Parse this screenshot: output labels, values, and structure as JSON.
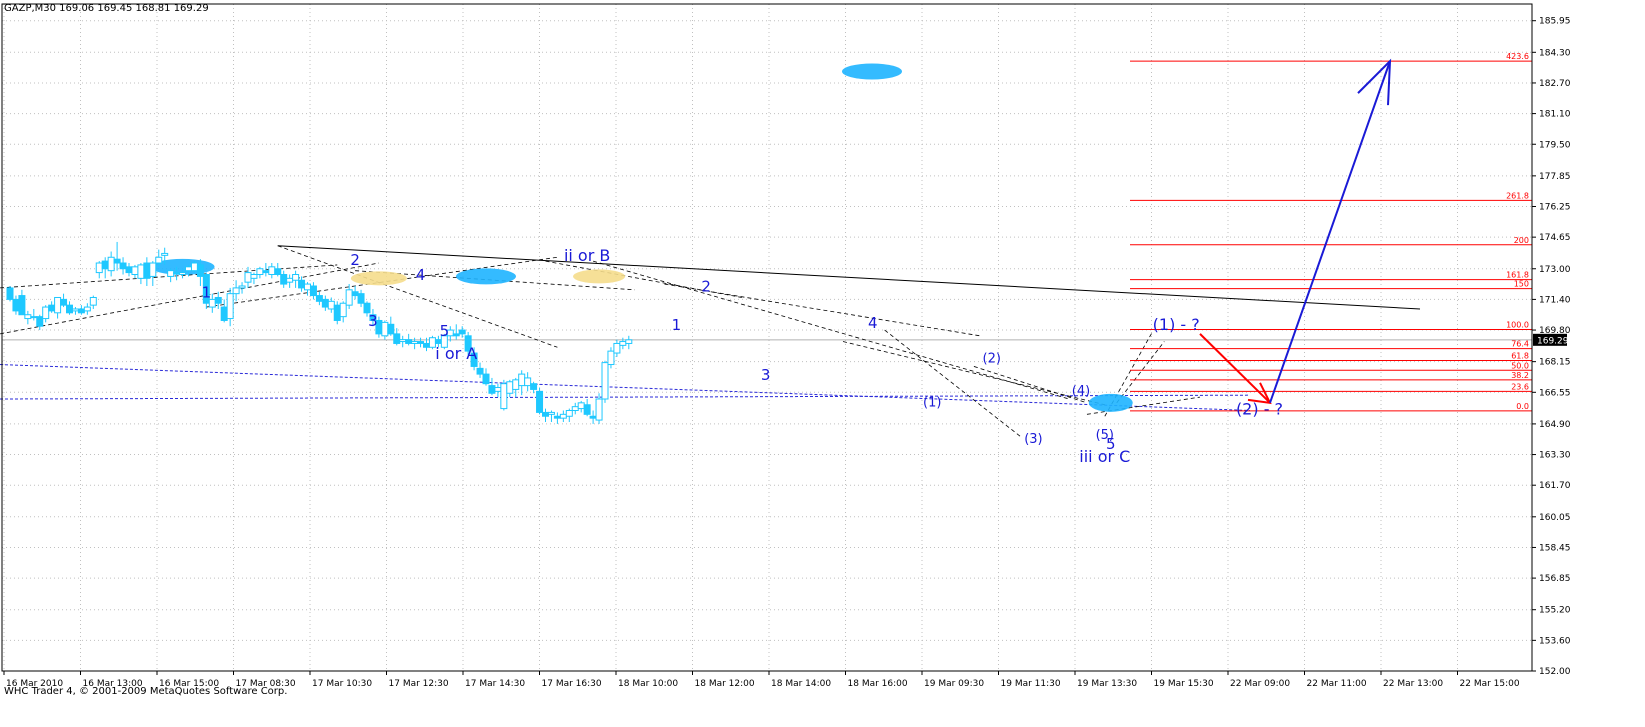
{
  "header": {
    "symbol_line": "GAZP,M30  169.06 169.45 168.81 169.29"
  },
  "footer": {
    "copyright": "WHC Trader 4, © 2001-2009 MetaQuotes Software Corp."
  },
  "colors": {
    "background": "#ffffff",
    "grid": "#c0c0c0",
    "bull": "#ffffff",
    "bear": "#1ec8ff",
    "candle_outline": "#1ec8ff",
    "fib": "#ff0000",
    "wave_label": "#1a1ad6",
    "arrow_up": "#1a1ad6",
    "arrow_down": "#ff0000",
    "highlight": "#f5dd8c",
    "marker": "#1eb4ff"
  },
  "chart_data": {
    "type": "candlestick",
    "ylim": [
      152.0,
      186.3
    ],
    "y_ticks": [
      "185.95",
      "184.30",
      "182.70",
      "181.10",
      "179.50",
      "177.85",
      "176.25",
      "174.65",
      "173.00",
      "171.40",
      "169.80",
      "168.15",
      "166.55",
      "164.90",
      "163.30",
      "161.70",
      "160.05",
      "158.45",
      "156.85",
      "155.20",
      "153.60",
      "152.00"
    ],
    "x_ticks": [
      "16 Mar 2010",
      "16 Mar 13:00",
      "16 Mar 15:00",
      "17 Mar 08:30",
      "17 Mar 10:30",
      "17 Mar 12:30",
      "17 Mar 14:30",
      "17 Mar 16:30",
      "18 Mar 10:00",
      "18 Mar 12:00",
      "18 Mar 14:00",
      "18 Mar 16:00",
      "19 Mar 09:30",
      "19 Mar 11:30",
      "19 Mar 13:30",
      "19 Mar 15:30",
      "22 Mar 09:00",
      "22 Mar 11:00",
      "22 Mar 13:00",
      "22 Mar 15:00"
    ],
    "current_price": "169.29",
    "candles": [
      [
        172.0,
        172.1,
        171.3,
        171.4
      ],
      [
        171.4,
        171.6,
        170.6,
        170.8
      ],
      [
        171.6,
        171.9,
        170.6,
        170.6
      ],
      [
        170.4,
        170.8,
        170.1,
        170.6
      ],
      [
        170.5,
        170.9,
        170.3,
        170.5
      ],
      [
        170.5,
        170.6,
        169.8,
        170.0
      ],
      [
        170.4,
        171.1,
        170.2,
        171.0
      ],
      [
        171.1,
        171.3,
        170.7,
        170.8
      ],
      [
        170.7,
        171.5,
        170.4,
        171.5
      ],
      [
        171.4,
        171.7,
        171.0,
        171.1
      ],
      [
        171.1,
        171.3,
        170.6,
        170.7
      ],
      [
        170.8,
        171.0,
        170.6,
        170.9
      ],
      [
        170.9,
        171.1,
        170.6,
        170.7
      ],
      [
        170.8,
        171.2,
        170.6,
        171.0
      ],
      [
        171.1,
        171.6,
        170.9,
        171.5
      ],
      [
        172.8,
        173.4,
        172.5,
        173.3
      ],
      [
        173.4,
        173.6,
        172.5,
        173.0
      ],
      [
        172.9,
        173.9,
        172.6,
        173.6
      ],
      [
        173.5,
        174.4,
        172.9,
        173.3
      ],
      [
        173.3,
        173.6,
        172.7,
        173.0
      ],
      [
        173.1,
        173.3,
        172.6,
        172.8
      ],
      [
        172.7,
        173.2,
        172.5,
        173.1
      ],
      [
        172.5,
        173.3,
        172.2,
        173.2
      ],
      [
        173.3,
        173.6,
        172.1,
        172.5
      ],
      [
        172.6,
        173.4,
        172.1,
        173.3
      ],
      [
        173.3,
        174.0,
        173.1,
        173.6
      ],
      [
        173.7,
        174.1,
        173.2,
        173.8
      ],
      [
        172.6,
        173.0,
        172.3,
        172.9
      ],
      [
        172.8,
        173.1,
        172.4,
        172.8
      ],
      [
        172.7,
        173.0,
        172.5,
        172.8
      ],
      [
        172.9,
        173.2,
        172.6,
        173.1
      ],
      [
        172.9,
        173.4,
        172.8,
        173.3
      ],
      [
        173.2,
        173.5,
        172.1,
        172.6
      ],
      [
        172.7,
        172.8,
        170.9,
        171.2
      ],
      [
        171.0,
        171.7,
        170.7,
        171.4
      ],
      [
        171.5,
        171.8,
        170.9,
        171.2
      ],
      [
        171.0,
        171.4,
        170.2,
        170.3
      ],
      [
        170.4,
        172.0,
        170.0,
        171.7
      ],
      [
        171.7,
        172.4,
        171.3,
        172.0
      ],
      [
        172.0,
        172.3,
        171.7,
        172.1
      ],
      [
        172.3,
        173.1,
        172.0,
        172.8
      ],
      [
        172.5,
        172.8,
        172.2,
        172.7
      ],
      [
        172.7,
        173.1,
        172.5,
        173.0
      ],
      [
        172.9,
        173.3,
        172.6,
        172.8
      ],
      [
        172.7,
        173.3,
        172.5,
        173.1
      ],
      [
        173.0,
        173.3,
        172.6,
        172.7
      ],
      [
        172.7,
        172.9,
        172.0,
        172.2
      ],
      [
        172.3,
        172.7,
        172.0,
        172.5
      ],
      [
        172.4,
        172.9,
        172.0,
        172.7
      ],
      [
        172.4,
        172.6,
        171.8,
        172.0
      ],
      [
        171.9,
        172.3,
        171.6,
        172.2
      ],
      [
        172.1,
        172.3,
        171.4,
        171.6
      ],
      [
        171.6,
        171.8,
        171.1,
        171.3
      ],
      [
        171.4,
        171.6,
        170.8,
        171.0
      ],
      [
        170.9,
        171.5,
        170.7,
        171.3
      ],
      [
        171.1,
        171.3,
        170.1,
        170.3
      ],
      [
        170.5,
        171.3,
        170.2,
        171.2
      ],
      [
        171.1,
        172.2,
        170.9,
        171.9
      ],
      [
        171.8,
        172.1,
        171.4,
        171.6
      ],
      [
        171.7,
        171.9,
        171.0,
        171.2
      ],
      [
        171.2,
        171.3,
        170.5,
        170.7
      ],
      [
        170.6,
        170.9,
        170.0,
        170.3
      ],
      [
        170.3,
        170.5,
        169.4,
        169.6
      ],
      [
        169.5,
        170.3,
        169.3,
        170.2
      ],
      [
        170.1,
        170.5,
        169.5,
        169.6
      ],
      [
        169.6,
        169.9,
        169.0,
        169.1
      ],
      [
        169.2,
        169.5,
        168.9,
        169.3
      ],
      [
        169.3,
        169.6,
        169.0,
        169.1
      ],
      [
        169.1,
        169.4,
        168.8,
        169.2
      ],
      [
        169.2,
        169.4,
        168.9,
        169.1
      ],
      [
        169.1,
        169.4,
        168.7,
        168.9
      ],
      [
        168.9,
        169.5,
        168.8,
        169.4
      ],
      [
        169.3,
        169.5,
        168.9,
        169.1
      ],
      [
        168.9,
        169.6,
        168.8,
        169.5
      ],
      [
        169.5,
        170.0,
        169.2,
        169.8
      ],
      [
        169.6,
        170.1,
        169.3,
        169.5
      ],
      [
        169.8,
        170.0,
        169.4,
        169.6
      ],
      [
        169.5,
        169.7,
        168.5,
        168.7
      ],
      [
        168.6,
        168.9,
        167.7,
        167.9
      ],
      [
        167.8,
        168.1,
        167.3,
        167.5
      ],
      [
        167.5,
        167.8,
        166.9,
        167.0
      ],
      [
        166.9,
        167.3,
        166.4,
        166.5
      ],
      [
        166.6,
        167.0,
        166.3,
        166.8
      ],
      [
        165.7,
        167.2,
        165.6,
        167.0
      ],
      [
        166.5,
        167.2,
        166.3,
        167.1
      ],
      [
        166.7,
        167.3,
        166.3,
        167.2
      ],
      [
        166.9,
        167.7,
        166.4,
        167.5
      ],
      [
        166.9,
        167.6,
        166.6,
        167.3
      ],
      [
        167.0,
        167.1,
        166.5,
        166.7
      ],
      [
        166.6,
        166.8,
        165.4,
        165.5
      ],
      [
        165.5,
        165.7,
        165.0,
        165.3
      ],
      [
        165.4,
        165.6,
        165.0,
        165.5
      ],
      [
        165.3,
        165.5,
        164.9,
        165.2
      ],
      [
        165.2,
        165.6,
        165.0,
        165.4
      ],
      [
        165.3,
        165.7,
        165.0,
        165.6
      ],
      [
        165.6,
        166.0,
        165.4,
        165.8
      ],
      [
        165.7,
        166.1,
        165.5,
        166.0
      ],
      [
        165.9,
        166.2,
        165.3,
        165.4
      ],
      [
        165.3,
        165.6,
        164.9,
        165.2
      ],
      [
        165.1,
        166.5,
        164.9,
        166.2
      ],
      [
        166.2,
        168.2,
        166.0,
        168.1
      ],
      [
        168.0,
        168.9,
        167.8,
        168.7
      ],
      [
        168.6,
        169.3,
        168.4,
        169.1
      ],
      [
        169.0,
        169.4,
        168.8,
        169.2
      ],
      [
        169.1,
        169.5,
        168.8,
        169.29
      ]
    ],
    "fibonacci": {
      "levels": [
        "423.6",
        "261.8",
        "200",
        "161.8",
        "150",
        "100.0",
        "76.4",
        "61.8",
        "50.0",
        "38.2",
        "23.6",
        "0.0"
      ],
      "prices": [
        183.84,
        176.57,
        174.25,
        172.43,
        171.96,
        169.83,
        168.83,
        168.21,
        167.7,
        167.2,
        166.6,
        165.58
      ]
    },
    "wave_labels": [
      {
        "text": "1",
        "x": 33,
        "price": 171.5,
        "size": 15
      },
      {
        "text": "2",
        "x": 58,
        "price": 173.2,
        "size": 15
      },
      {
        "text": "3",
        "x": 61,
        "price": 170.0,
        "size": 15
      },
      {
        "text": "4",
        "x": 69,
        "price": 172.4,
        "size": 15
      },
      {
        "text": "5",
        "x": 73,
        "price": 169.5,
        "size": 15
      },
      {
        "text": "i or A",
        "x": 75,
        "price": 168.3,
        "size": 16
      },
      {
        "text": "ii or B",
        "x": 97,
        "price": 173.4,
        "size": 16
      },
      {
        "text": "2",
        "x": 117,
        "price": 171.8,
        "size": 15
      },
      {
        "text": "1",
        "x": 112,
        "price": 169.8,
        "size": 15
      },
      {
        "text": "3",
        "x": 127,
        "price": 167.2,
        "size": 15
      },
      {
        "text": "4",
        "x": 145,
        "price": 169.9,
        "size": 15
      },
      {
        "text": "(1)",
        "x": 155,
        "price": 165.8,
        "size": 13
      },
      {
        "text": "(2)",
        "x": 165,
        "price": 168.1,
        "size": 13
      },
      {
        "text": "(3)",
        "x": 172,
        "price": 163.9,
        "size": 13
      },
      {
        "text": "(4)",
        "x": 180,
        "price": 166.4,
        "size": 13
      },
      {
        "text": "(5)",
        "x": 184,
        "price": 164.1,
        "size": 13
      },
      {
        "text": "5",
        "x": 185,
        "price": 163.6,
        "size": 15
      },
      {
        "text": "iii or C",
        "x": 184,
        "price": 162.9,
        "size": 16
      },
      {
        "text": "(1) - ?",
        "x": 196,
        "price": 169.8,
        "size": 16
      },
      {
        "text": "(2) - ?",
        "x": 210,
        "price": 165.4,
        "size": 16
      }
    ]
  }
}
